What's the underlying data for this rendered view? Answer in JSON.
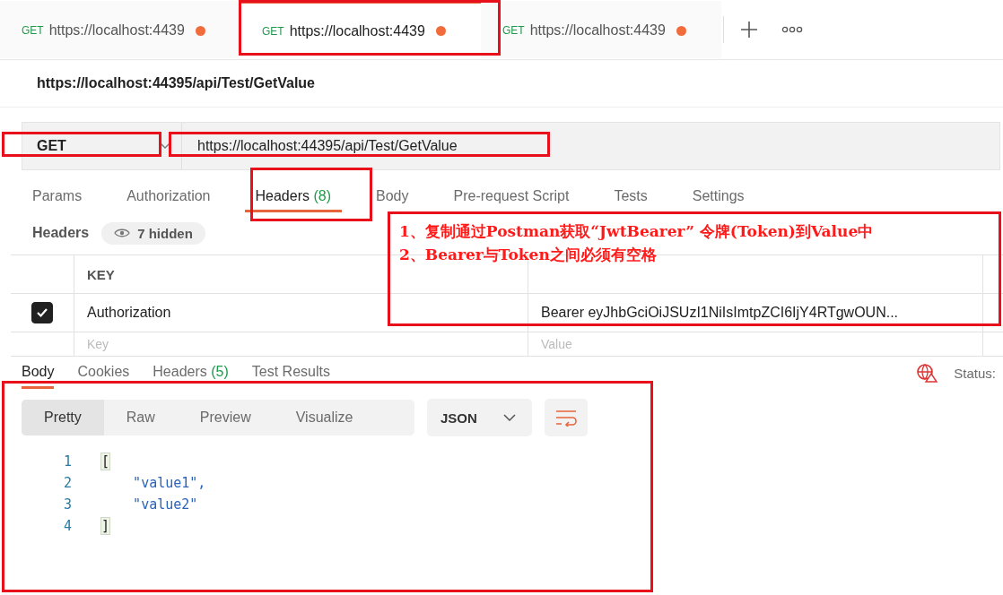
{
  "tabs": [
    {
      "method": "GET",
      "url": "https://localhost:4439",
      "selected": false,
      "unsaved": true
    },
    {
      "method": "GET",
      "url": "https://localhost:4439",
      "selected": true,
      "unsaved": true
    },
    {
      "method": "GET",
      "url": "https://localhost:4439",
      "selected": false,
      "unsaved": true
    }
  ],
  "request_title": "https://localhost:44395/api/Test/GetValue",
  "request": {
    "method": "GET",
    "url": "https://localhost:44395/api/Test/GetValue"
  },
  "request_tabs": [
    {
      "label": "Params",
      "selected": false
    },
    {
      "label": "Authorization",
      "selected": false
    },
    {
      "label": "Headers",
      "count": "(8)",
      "selected": true
    },
    {
      "label": "Body",
      "selected": false
    },
    {
      "label": "Pre-request Script",
      "selected": false
    },
    {
      "label": "Tests",
      "selected": false
    },
    {
      "label": "Settings",
      "selected": false
    }
  ],
  "headers_label": "Headers",
  "hidden_headers": "7 hidden",
  "table": {
    "key_column": "KEY",
    "rows": [
      {
        "checked": true,
        "key": "Authorization",
        "value": "Bearer eyJhbGciOiJSUzI1NiIsImtpZCI6IjY4RTgwOUN..."
      }
    ],
    "key_placeholder": "Key",
    "value_placeholder": "Value"
  },
  "response_tabs": [
    {
      "label": "Body",
      "selected": true
    },
    {
      "label": "Cookies",
      "selected": false
    },
    {
      "label": "Headers",
      "count": "(5)",
      "selected": false
    },
    {
      "label": "Test Results",
      "selected": false
    }
  ],
  "status_label": "Status:",
  "view_modes": [
    {
      "label": "Pretty",
      "selected": true
    },
    {
      "label": "Raw",
      "selected": false
    },
    {
      "label": "Preview",
      "selected": false
    },
    {
      "label": "Visualize",
      "selected": false
    }
  ],
  "format": "JSON",
  "code_lines": [
    {
      "number": "1",
      "text": "[",
      "kind": "bracket"
    },
    {
      "number": "2",
      "text": "    \"value1\",",
      "kind": "string"
    },
    {
      "number": "3",
      "text": "    \"value2\"",
      "kind": "string"
    },
    {
      "number": "4",
      "text": "]",
      "kind": "bracket"
    }
  ],
  "annotation": [
    "1、复制通过Postman获取“JwtBearer” 令牌(Token)到Value中",
    "2、Bearer与Token之间必须有空格"
  ]
}
